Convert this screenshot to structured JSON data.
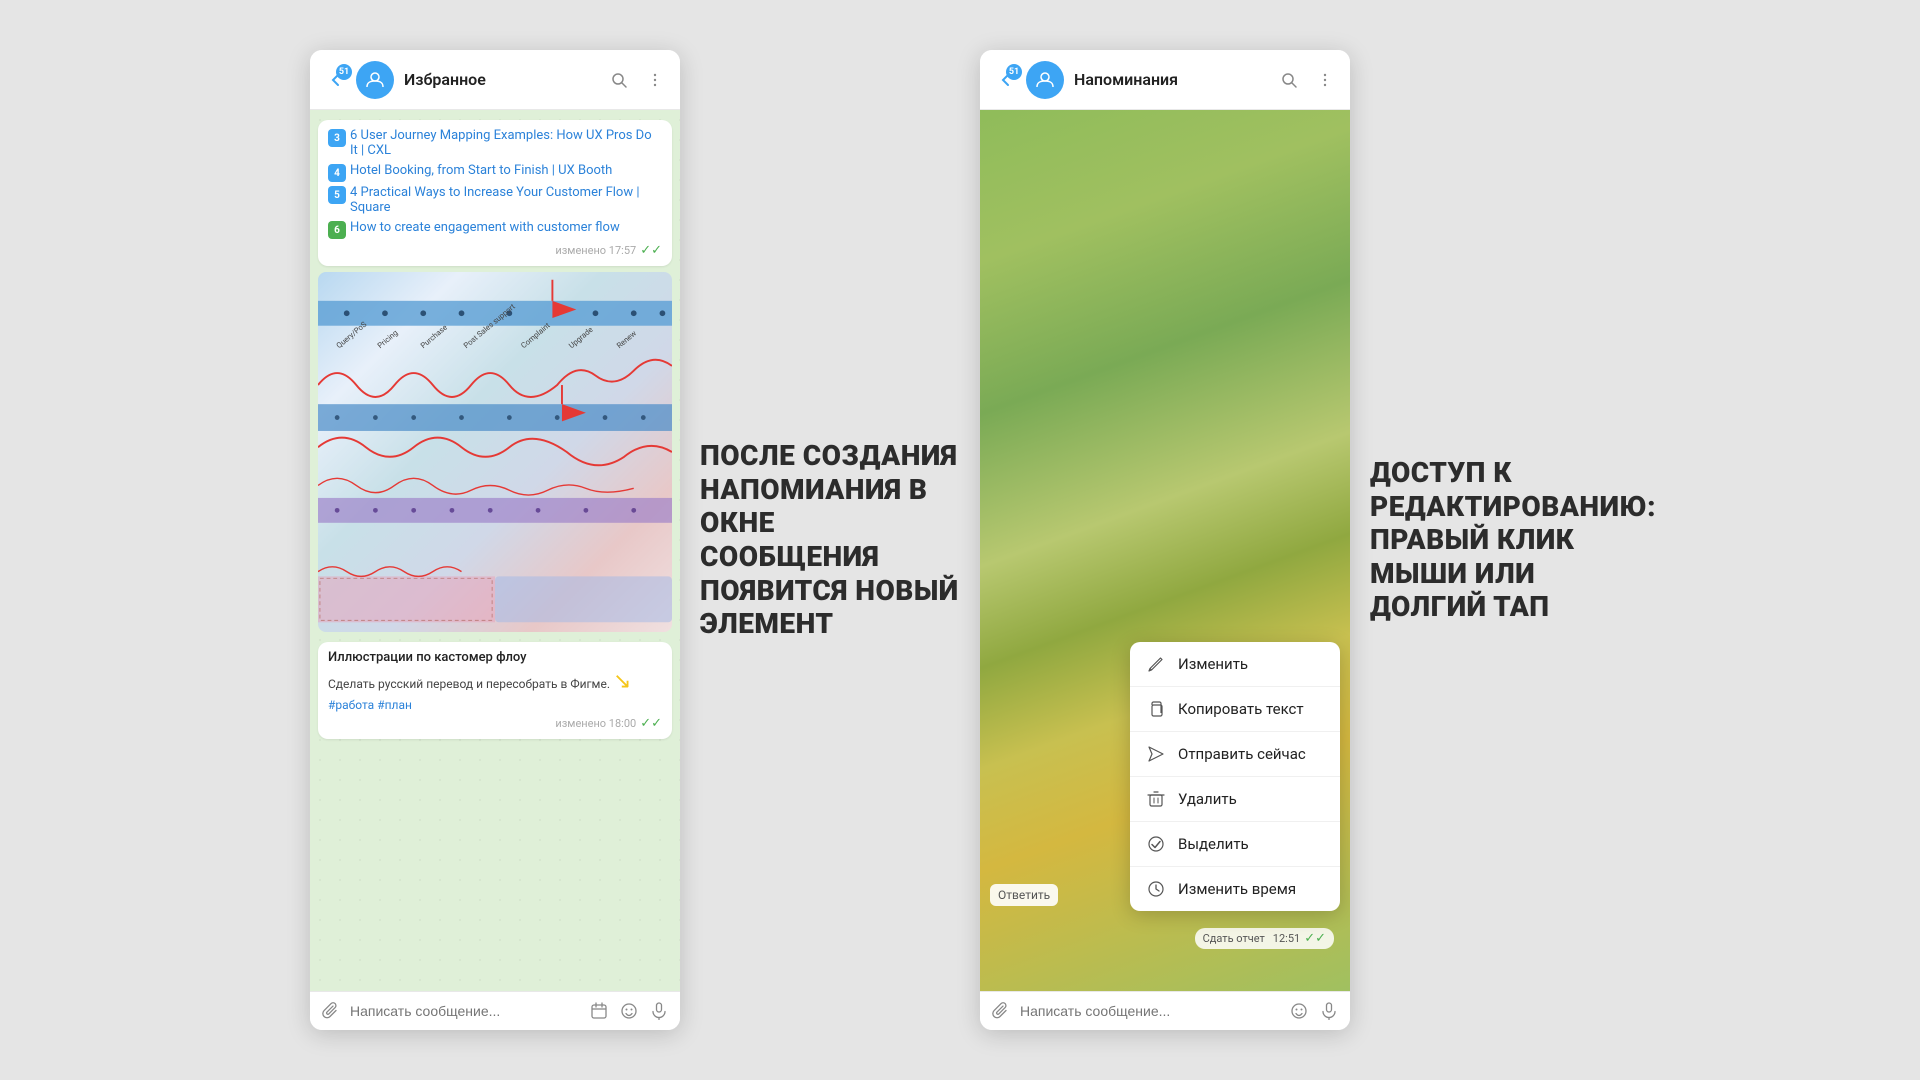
{
  "left_window": {
    "header": {
      "title": "Избранное",
      "badge": "51",
      "search_label": "search",
      "menu_label": "menu"
    },
    "messages": [
      {
        "id": "msg1",
        "links": [
          {
            "num": "3",
            "color": "blue",
            "text": "6 User Journey Mapping Examples: How UX Pros Do It | CXL"
          },
          {
            "num": "4",
            "color": "blue",
            "text": "Hotel Booking, from Start to Finish | UX Booth"
          },
          {
            "num": "5",
            "color": "blue",
            "text": "4 Practical Ways to Increase Your Customer Flow | Square"
          },
          {
            "num": "6",
            "color": "green",
            "text": "How to create engagement with customer flow"
          }
        ],
        "meta": "изменено 17:57"
      },
      {
        "id": "msg2",
        "is_image": true
      },
      {
        "id": "msg3",
        "caption_title": "Иллюстрации по кастомер флоу",
        "caption_note": "Сделать русский перевод и пересобрать в Фигме.",
        "tags": "#работа #план",
        "meta": "изменено 18:00"
      }
    ],
    "input_placeholder": "Написать сообщение...",
    "flow_labels": [
      "Query/PoS",
      "Pricing",
      "Purchase",
      "Post Sales support",
      "Complaint",
      "Upgrade",
      "Renew"
    ]
  },
  "middle_annotation": {
    "text": "ПОСЛЕ СОЗДАНИЯ НАПОМИАНИЯ В ОКНЕ СООБЩЕНИЯ ПОЯВИТСЯ НОВЫЙ ЭЛЕМЕНТ"
  },
  "right_window": {
    "header": {
      "title": "Напоминания",
      "badge": "51"
    },
    "context_menu": {
      "items": [
        {
          "icon": "✏️",
          "label": "Изменить"
        },
        {
          "icon": "📋",
          "label": "Копировать текст"
        },
        {
          "icon": "➤",
          "label": "Отправить сейчас"
        },
        {
          "icon": "🗑️",
          "label": "Удалить"
        },
        {
          "icon": "✓",
          "label": "Выделить"
        },
        {
          "icon": "⏰",
          "label": "Изменить время"
        }
      ]
    },
    "report_btn": "Ответить",
    "time_badge": "12:51",
    "report_btn2": "Сдать отчет",
    "input_placeholder": "Написать сообщение..."
  },
  "right_annotation": {
    "text": "ДОСТУП К РЕДАКТИРОВАНИЮ: ПРАВЫЙ КЛИК МЫШИ ИЛИ ДОЛГИЙ ТАП"
  }
}
